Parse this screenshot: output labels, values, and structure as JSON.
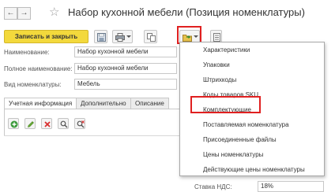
{
  "header": {
    "title": "Набор кухонной мебели (Позиция номенклатуры)",
    "back_glyph": "←",
    "forward_glyph": "→",
    "star_glyph": "☆"
  },
  "toolbar": {
    "save_close_label": "Записать и закрыть"
  },
  "form": {
    "name_label": "Наименование:",
    "name_value": "Набор кухонной мебели",
    "full_name_label": "Полное наименование:",
    "full_name_value": "Набор кухонной мебели",
    "kind_label": "Вид номенклатуры:",
    "kind_value": "Мебель"
  },
  "tabs": [
    {
      "label": "Учетная информация",
      "active": true
    },
    {
      "label": "Дополнительно",
      "active": false
    },
    {
      "label": "Описание",
      "active": false
    }
  ],
  "menu": {
    "items": [
      "Характеристики",
      "Упаковки",
      "Штрихкоды",
      "Коды товаров SKU",
      "Комплектующие",
      "Поставляемая номенклатура",
      "Присоединенные файлы",
      "Цены номенклатуры",
      "Действующие цены номенклатуры"
    ],
    "highlighted": "Комплектующие"
  },
  "vat": {
    "label": "Ставка НДС:",
    "value": "18%"
  },
  "colors": {
    "primary_button": "#f3d93c",
    "highlight_border": "#e02020"
  }
}
